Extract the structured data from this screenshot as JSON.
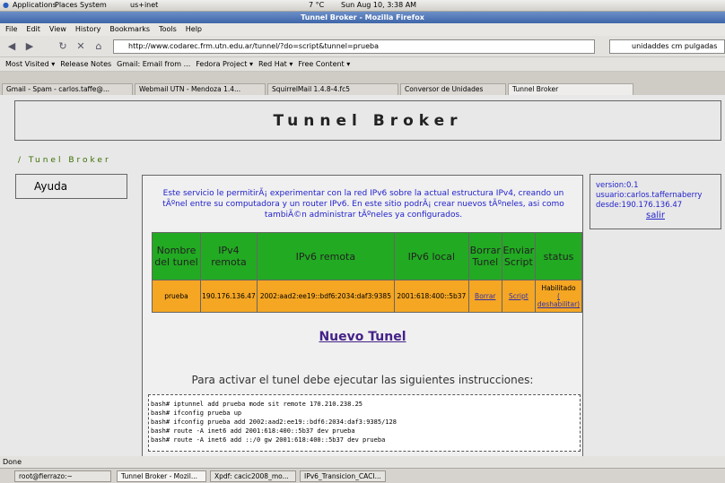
{
  "panel": {
    "apps": "Applications",
    "places": "Places",
    "system": "System",
    "user": "us+inet",
    "weather": "7 °C",
    "datetime": "Sun Aug 10,  3:38 AM"
  },
  "window": {
    "title": "Tunnel Broker - Mozilla Firefox"
  },
  "menu": [
    "File",
    "Edit",
    "View",
    "History",
    "Bookmarks",
    "Tools",
    "Help"
  ],
  "nav": {
    "url": "http://www.codarec.frm.utn.edu.ar/tunnel/?do=script&tunnel=prueba",
    "search": "unidaddes cm pulgadas"
  },
  "bookmarks": [
    "Most Visited ▾",
    "Release Notes",
    "Gmail: Email from ...",
    "Fedora Project ▾",
    "Red Hat ▾",
    "Free Content ▾"
  ],
  "tabs": [
    "Gmail - Spam - carlos.taffe@...",
    "Webmail UTN - Mendoza 1.4...",
    "SquirrelMail 1.4.8-4.fc5",
    "Conversor de Unidades",
    "Tunnel Broker"
  ],
  "page": {
    "title": "Tunnel Broker",
    "breadcrumb": "/ Tunel Broker",
    "ayuda": "Ayuda",
    "intro": "Este servicio le permitirÃ¡ experimentar con la red IPv6 sobre la actual estructura IPv4, creando un tÃºnel entre su computadora y un router IPv6. En este sitio podrÃ¡ crear nuevos tÃºneles, asi como tambiÃ©n administrar tÃºneles ya configurados.",
    "headers": [
      "Nombre del tunel",
      "IPv4 remota",
      "IPv6 remota",
      "IPv6 local",
      "Borrar Tunel",
      "Enviar Script",
      "status"
    ],
    "row": {
      "name": "prueba",
      "ipv4": "190.176.136.47",
      "ipv6r": "2002:aad2:ee19::bdf6:2034:daf3:9385",
      "ipv6l": "2001:618:400::5b37",
      "borrar": "Borrar",
      "script": "Script",
      "status": "Habilitado",
      "deshab": "( deshabilitar)"
    },
    "nuevo": "Nuevo Tunel",
    "activar": "Para activar el tunel debe ejecutar las siguientes instrucciones:",
    "code": "bash# iptunnel add prueba mode sit remote 170.210.238.25\nbash# ifconfig prueba up\nbash# ifconfig prueba add 2002:aad2:ee19::bdf6:2034:daf3:9385/128\nbash# route -A inet6 add 2001:618:400::5b37 dev prueba\nbash# route -A inet6 add ::/0 gw 2001:618:400::5b37 dev prueba",
    "info": {
      "version": "version:0.1",
      "usuario": "usuario:carlos.taffernaberry",
      "desde": "desde:190.176.136.47",
      "salir": "salir"
    }
  },
  "status": "Done",
  "taskbar": [
    "root@fierrazo:~",
    "Tunnel Broker - Mozil...",
    "Xpdf: cacic2008_mo...",
    "IPv6_Transicion_CACI..."
  ]
}
